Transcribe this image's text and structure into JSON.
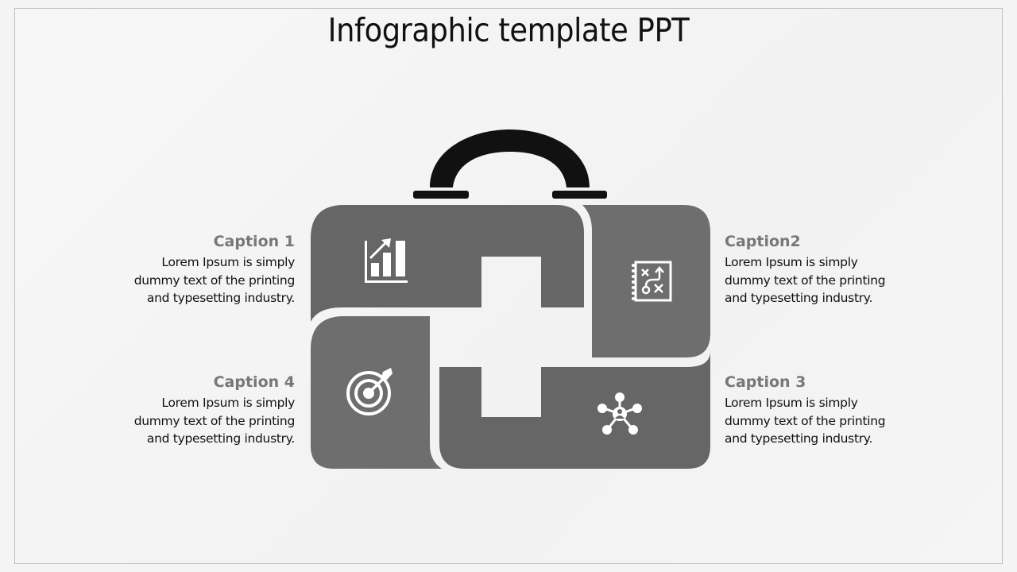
{
  "slide": {
    "title": "Infographic template PPT"
  },
  "colors": {
    "piece_fill": "#666666",
    "piece_fill_alt": "#6e6e6e",
    "handle": "#111111",
    "icon": "#ffffff",
    "caption_title": "#777777",
    "body_text": "#111111"
  },
  "captions": [
    {
      "title": "Caption 1",
      "body_lines": [
        "Lorem Ipsum is simply",
        "dummy text of the printing",
        "and typesetting industry."
      ],
      "icon": "bar-chart-growth-icon",
      "position": "left-top"
    },
    {
      "title": "Caption2",
      "body_lines": [
        "Lorem Ipsum is simply",
        "dummy text of the printing",
        "and typesetting industry."
      ],
      "icon": "strategy-board-icon",
      "position": "right-top"
    },
    {
      "title": "Caption 3",
      "body_lines": [
        "Lorem Ipsum is simply",
        "dummy text of the printing",
        "and typesetting industry."
      ],
      "icon": "network-person-icon",
      "position": "right-bottom"
    },
    {
      "title": "Caption 4",
      "body_lines": [
        "Lorem Ipsum is simply",
        "dummy text of the printing",
        "and typesetting industry."
      ],
      "icon": "target-arrow-icon",
      "position": "left-bottom"
    }
  ]
}
